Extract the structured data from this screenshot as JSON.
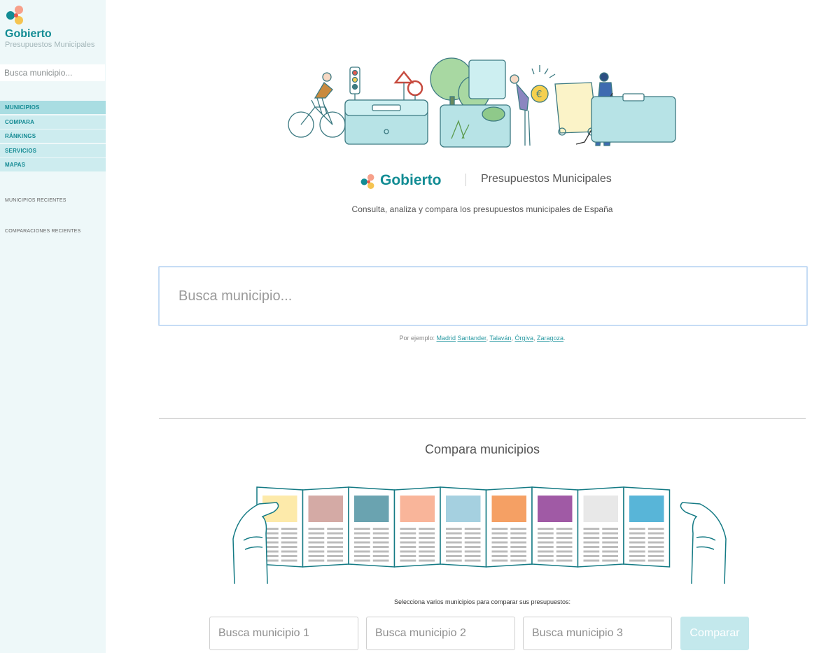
{
  "sidebar": {
    "brand_name": "Gobierto",
    "brand_sub": "Presupuestos Municipales",
    "search_placeholder": "Busca municipio...",
    "nav": [
      {
        "label": "MUNICIPIOS",
        "active": true
      },
      {
        "label": "COMPARA",
        "active": false
      },
      {
        "label": "RÁNKINGS",
        "active": false
      },
      {
        "label": "SERVICIOS",
        "active": false
      },
      {
        "label": "MAPAS",
        "active": false
      }
    ],
    "recent_municipios": "MUNICIPIOS RECIENTES",
    "recent_comparaciones": "COMPARACIONES RECIENTES"
  },
  "main": {
    "brand_name": "Gobierto",
    "brand_sub": "Presupuestos Municipales",
    "tagline": "Consulta, analiza y compara los presupuestos municipales de España",
    "search_placeholder": "Busca municipio...",
    "examples_prefix": "Por ejemplo: ",
    "examples": [
      "Madrid",
      "Santander",
      "Talaván",
      "Órgiva",
      "Zaragoza"
    ],
    "compare_title": "Compara municipios",
    "compare_hint": "Selecciona varios municipios para comparar sus presupuestos:",
    "compare_inputs": [
      "Busca municipio 1",
      "Busca municipio 2",
      "Busca municipio 3"
    ],
    "compare_button": "Comparar"
  },
  "colors": {
    "brand": "#128c94",
    "sidebar_bg": "#eef8f9",
    "nav_bg": "#cdecef",
    "nav_active_bg": "#a9dde2",
    "compare_panels": [
      "#fdeaaa",
      "#d4aaa5",
      "#6aa3b0",
      "#f9b59a",
      "#a5d0e0",
      "#f5a064",
      "#a05aa5",
      "#e8e8e8",
      "#58b5d8"
    ]
  },
  "icons": [
    "gobierto-logo-icon",
    "hero-illustration",
    "compare-illustration"
  ]
}
